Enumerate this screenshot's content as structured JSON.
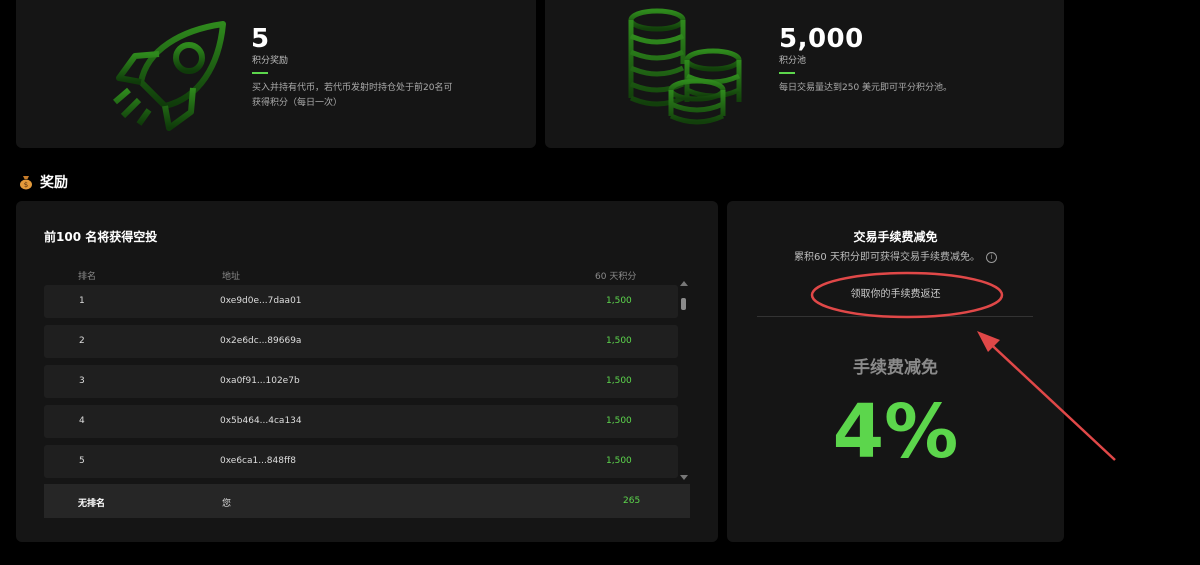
{
  "points_card": {
    "value": "5",
    "label": "积分奖励",
    "description_line1": "买入并持有代币，若代币发射时持仓处于前20名可",
    "description_line2": "获得积分（每日一次）",
    "icon": "rocket-icon"
  },
  "pool_card": {
    "value": "5,000",
    "label": "积分池",
    "description": "每日交易量达到250 美元即可平分积分池。",
    "icon": "coins-icon"
  },
  "rewards_section": {
    "icon": "money-bag-icon",
    "title": "奖励"
  },
  "leaderboard": {
    "title": "前100 名将获得空投",
    "columns": {
      "rank": "排名",
      "address": "地址",
      "points": "60 天积分"
    },
    "rows": [
      {
        "rank": "1",
        "address": "0xe9d0e...7daa01",
        "points": "1,500"
      },
      {
        "rank": "2",
        "address": "0x2e6dc...89669a",
        "points": "1,500"
      },
      {
        "rank": "3",
        "address": "0xa0f91...102e7b",
        "points": "1,500"
      },
      {
        "rank": "4",
        "address": "0x5b464...4ca134",
        "points": "1,500"
      },
      {
        "rank": "5",
        "address": "0xe6ca1...848ff8",
        "points": "1,500"
      }
    ],
    "self_row": {
      "rank": "无排名",
      "address": "您",
      "points": "265"
    }
  },
  "fee_card": {
    "title": "交易手续费减免",
    "subtitle": "累积60 天积分即可获得交易手续费减免。",
    "info_icon": "info-icon",
    "claim_link": "领取你的手续费返还",
    "fee_label": "手续费减免",
    "fee_value": "4%"
  },
  "colors": {
    "accent_green": "#5cd64c",
    "card_bg": "#151515",
    "annotation_red": "#e04848"
  }
}
